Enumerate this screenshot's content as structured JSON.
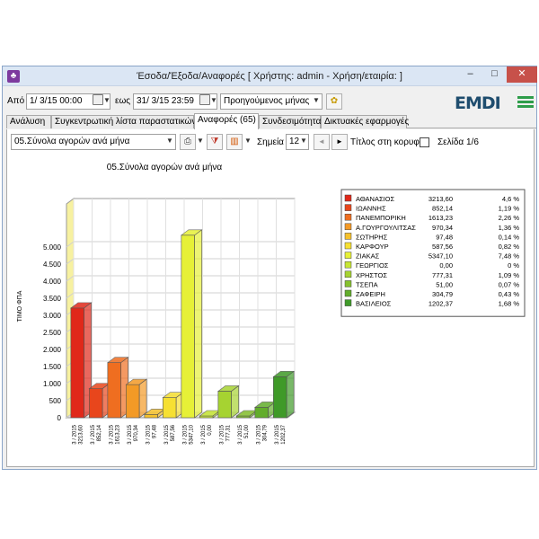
{
  "window": {
    "title": "Έσοδα/Έξοδα/Αναφορές   [ Χρήστης: admin - Χρήση/εταιρία:                ]",
    "minimize": "–",
    "maximize": "□",
    "close": "✕",
    "app_icon": "app-icon"
  },
  "filters": {
    "from_label": "Από",
    "from_value": "1/  3/15 00:00",
    "to_label": "εως",
    "to_value": "31/  3/15 23:59",
    "period_value": "Προηγούμενος μήνας",
    "logo_text": "EMDI"
  },
  "tabs": [
    {
      "label": "Ανάλυση",
      "active": false
    },
    {
      "label": "Συγκεντρωτική λίστα παραστατικών",
      "active": false
    },
    {
      "label": "Αναφορές (65)",
      "active": true
    },
    {
      "label": "Συνδεσιμότητα",
      "active": false
    },
    {
      "label": "Δικτυακές εφαρμογές",
      "active": false
    }
  ],
  "report_toolbar": {
    "report_select": "05.Σύνολα αγορών ανά μήνα",
    "points_label": "Σημεία",
    "points_value": "12",
    "title_top_label": "Τίτλος στη κορυφή",
    "title_top_checked": false,
    "page_label": "Σελίδα 1/6",
    "prev_arrow": "◄",
    "next_arrow": "►"
  },
  "chart_data": {
    "type": "bar",
    "title": "05.Σύνολα αγορών ανά μήνα",
    "ylabel": "ΤΙΜΟ ΦΠΑ",
    "ylim": [
      0,
      6000
    ],
    "yticks": [
      "0",
      "500",
      "1.000",
      "1.500",
      "2.000",
      "2.500",
      "3.000",
      "3.500",
      "4.000",
      "4.500",
      "5.000"
    ],
    "grid": true,
    "legend_position": "right",
    "categories": [
      "ΑΘΑΝΑΣΙΟΣ",
      "ΙΩΑΝΝΗΣ",
      "ΠΑΝΕΜΠΟΡΙΚΗ",
      "Α.ΓΟΥΡΓΟΥΛΙΤΣΑΣ",
      "ΣΩΤΗΡΗΣ",
      "ΚΑΡΦΟΥΡ",
      "ΖΙΑΚΑΣ",
      "ΓΕΩΡΓΙΟΣ",
      "ΧΡΗΣΤΟΣ",
      "ΤΣΕΠΑ",
      "ΖΑΦΕΙΡΗ",
      "ΒΑΣΙΛΕΙΟΣ"
    ],
    "values": [
      3213.6,
      852.14,
      1613.23,
      970.34,
      97.48,
      587.56,
      5347.1,
      0.0,
      777.31,
      51.0,
      304.79,
      1202.37
    ],
    "value_labels": [
      "3213,60",
      "852,14",
      "1613,23",
      "970,34",
      "97,48",
      "587,56",
      "5347,10",
      "0,00",
      "777,31",
      "51,00",
      "304,79",
      "1202,37"
    ],
    "percent_labels": [
      "4,6 %",
      "1,19 %",
      "2,26 %",
      "1,36 %",
      "0,14 %",
      "0,82 %",
      "7,48 %",
      "0 %",
      "1,09 %",
      "0,07 %",
      "0,43 %",
      "1,68 %"
    ],
    "x_date_label": "3 / 2015",
    "colors": [
      "#e0281a",
      "#e8461c",
      "#ef6e20",
      "#f39a26",
      "#f5c12c",
      "#f6e032",
      "#e6f037",
      "#c7e634",
      "#a6d331",
      "#86c12e",
      "#62ad2b",
      "#3f9a28"
    ]
  }
}
